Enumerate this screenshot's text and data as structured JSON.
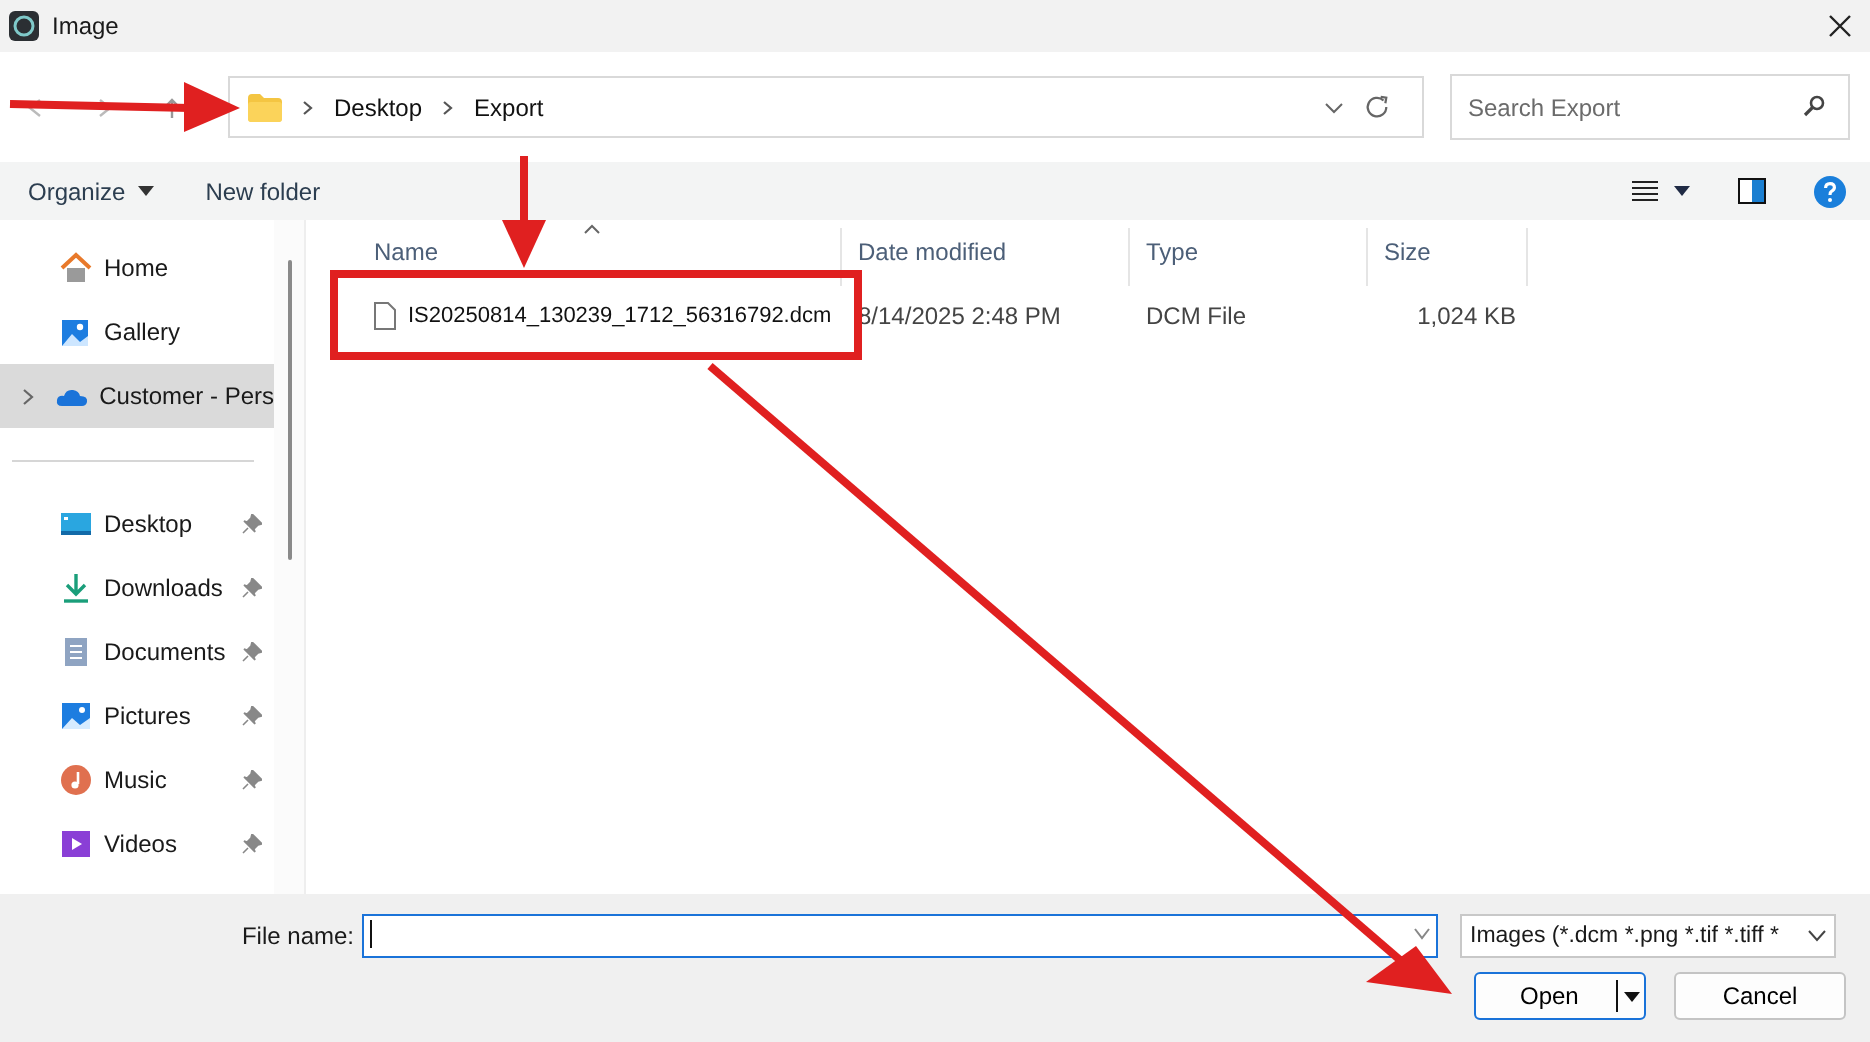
{
  "window": {
    "title": "Image"
  },
  "address": {
    "breadcrumbs": [
      "Desktop",
      "Export"
    ]
  },
  "search": {
    "placeholder": "Search Export"
  },
  "toolbar": [
    {
      "label": "Organize",
      "dropdown": true
    },
    {
      "label": "New folder",
      "dropdown": false
    }
  ],
  "sidebar": {
    "top_items": [
      {
        "label": "Home",
        "kind": "home",
        "selected": false,
        "expandable": false
      },
      {
        "label": "Gallery",
        "kind": "gallery",
        "selected": false,
        "expandable": false
      },
      {
        "label": "Customer - Pers",
        "kind": "cloud",
        "selected": true,
        "expandable": true
      }
    ],
    "quick_access": [
      {
        "label": "Desktop",
        "kind": "desktop",
        "pinned": true
      },
      {
        "label": "Downloads",
        "kind": "downloads",
        "pinned": true
      },
      {
        "label": "Documents",
        "kind": "documents",
        "pinned": true
      },
      {
        "label": "Pictures",
        "kind": "pictures",
        "pinned": true
      },
      {
        "label": "Music",
        "kind": "music",
        "pinned": true
      },
      {
        "label": "Videos",
        "kind": "videos",
        "pinned": true
      }
    ]
  },
  "table": {
    "columns": [
      {
        "label": "Name",
        "sorted": true
      },
      {
        "label": "Date modified",
        "sorted": false
      },
      {
        "label": "Type",
        "sorted": false
      },
      {
        "label": "Size",
        "sorted": false
      }
    ],
    "rows": [
      {
        "name": "IS20250814_130239_1712_56316792.dcm",
        "date_modified": "8/14/2025 2:48 PM",
        "type": "DCM File",
        "size": "1,024 KB"
      }
    ]
  },
  "footer": {
    "file_name_label": "File name:",
    "filter": "Images (*.dcm *.png *.tif *.tiff *",
    "buttons": [
      {
        "label": "Open",
        "kind": "split"
      },
      {
        "label": "Cancel",
        "kind": "plain"
      }
    ]
  }
}
